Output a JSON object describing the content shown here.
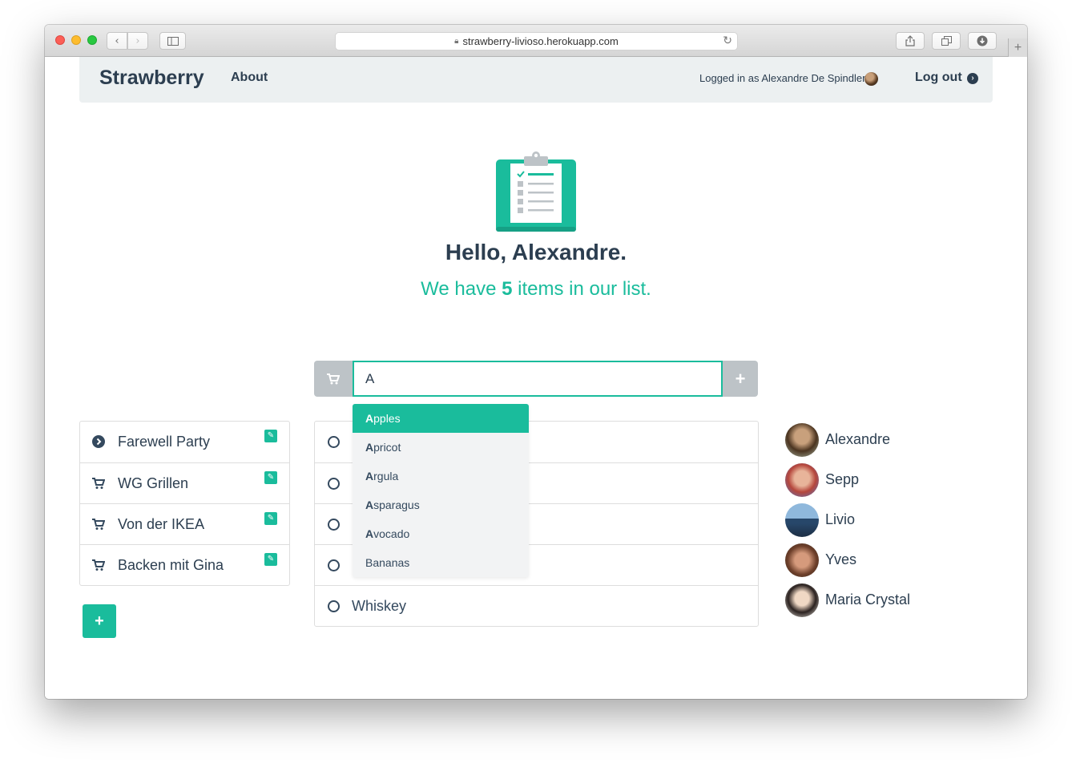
{
  "browser": {
    "url": "strawberry-livioso.herokuapp.com"
  },
  "navbar": {
    "brand": "Strawberry",
    "about": "About",
    "logged_in_text": "Logged in as Alexandre De Spindler",
    "logout": "Log out"
  },
  "hero": {
    "greeting": "Hello, Alexandre.",
    "sub_prefix": "We have ",
    "count": "5",
    "sub_suffix": " items in our list."
  },
  "add_item": {
    "value": "A"
  },
  "lists": [
    {
      "label": "Farewell Party",
      "icon": "chevron-circle-right-icon"
    },
    {
      "label": "WG Grillen",
      "icon": "cart-icon"
    },
    {
      "label": "Von der IKEA",
      "icon": "cart-icon"
    },
    {
      "label": "Backen mit Gina",
      "icon": "cart-icon"
    }
  ],
  "items": [
    {
      "label": ""
    },
    {
      "label": ""
    },
    {
      "label": ""
    },
    {
      "label": ""
    },
    {
      "label": "Whiskey"
    }
  ],
  "autocomplete": [
    {
      "match": "A",
      "rest": "pples"
    },
    {
      "match": "A",
      "rest": "pricot"
    },
    {
      "match": "A",
      "rest": "rgula"
    },
    {
      "match": "A",
      "rest": "sparagus"
    },
    {
      "match": "A",
      "rest": "vocado"
    },
    {
      "match": "",
      "rest": "Bananas"
    }
  ],
  "users": [
    {
      "name": "Alexandre"
    },
    {
      "name": "Sepp"
    },
    {
      "name": "Livio"
    },
    {
      "name": "Yves"
    },
    {
      "name": "Maria Crystal"
    }
  ],
  "colors": {
    "accent": "#1abc9c",
    "text": "#2c3e50",
    "navbar_bg": "#ecf0f1",
    "addon_bg": "#bdc3c7"
  }
}
